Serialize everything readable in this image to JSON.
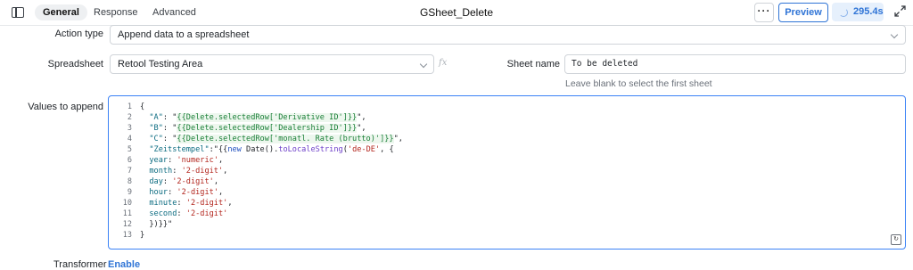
{
  "header": {
    "tabs": [
      {
        "label": "General",
        "active": true
      },
      {
        "label": "Response",
        "active": false
      },
      {
        "label": "Advanced",
        "active": false
      }
    ],
    "query_name": "GSheet_Delete",
    "more_label": "···",
    "preview_label": "Preview",
    "run_time": "295.4s"
  },
  "form": {
    "action_type": {
      "label": "Action type",
      "value": "Append data to a spreadsheet"
    },
    "spreadsheet": {
      "label": "Spreadsheet",
      "value": "Retool Testing Area",
      "fx": "fx"
    },
    "sheet_name": {
      "label": "Sheet name",
      "value": "To be deleted",
      "hint": "Leave blank to select the first sheet"
    },
    "values_to_append": {
      "label": "Values to append",
      "line_numbers": [
        "1",
        "2",
        "3",
        "4",
        "5",
        "6",
        "7",
        "8",
        "9",
        "10",
        "11",
        "12",
        "13"
      ],
      "lines": [
        "{",
        "  \"A\": \"{{Delete.selectedRow['Derivative ID']}}\",",
        "  \"B\": \"{{Delete.selectedRow['Dealership ID']}}\",",
        "  \"C\": \"{{Delete.selectedRow['monatl. Rate (brutto)']}}\",",
        "  \"Zeitstempel\":\"{{new Date().toLocaleString('de-DE', {",
        "  year: 'numeric',",
        "  month: '2-digit',",
        "  day: '2-digit',",
        "  hour: '2-digit',",
        "  minute: '2-digit',",
        "  second: '2-digit'",
        "  })}}\"",
        "}"
      ]
    },
    "transformer": {
      "label": "Transformer",
      "link": "Enable"
    }
  },
  "colors": {
    "accent": "#2f74d6",
    "editor_border": "#3b82f6",
    "template_green": "#1a7f37"
  }
}
